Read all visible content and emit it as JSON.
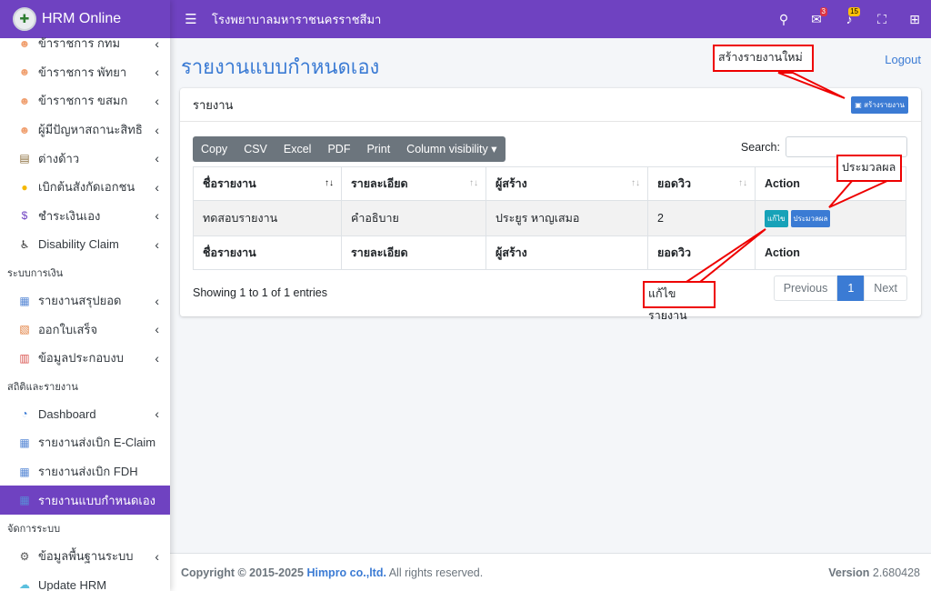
{
  "brand": {
    "name": "HRM Online"
  },
  "topbar": {
    "title": "โรงพยาบาลมหาราชนครราชสีมา",
    "chat_badge": "3",
    "bell_badge": "15"
  },
  "sidebar": {
    "items_a": [
      {
        "label": "ข้าราชการ กทม",
        "icon": "person-icon"
      },
      {
        "label": "ข้าราชการ พัทยา",
        "icon": "person-icon"
      },
      {
        "label": "ข้าราชการ ขสมก",
        "icon": "person-icon"
      },
      {
        "label": "ผู้มีปัญหาสถานะสิทธิ",
        "icon": "person-icon"
      },
      {
        "label": "ต่างด้าว",
        "icon": "passport-icon"
      },
      {
        "label": "เบิกต้นสังกัดเอกชน",
        "icon": "coin-icon"
      },
      {
        "label": "ชำระเงินเอง",
        "icon": "money-icon"
      },
      {
        "label": "Disability Claim",
        "icon": "wheelchair-icon"
      }
    ],
    "header_finance": "ระบบการเงิน",
    "items_b": [
      {
        "label": "รายงานสรุปยอด",
        "icon": "report-icon"
      },
      {
        "label": "ออกใบเสร็จ",
        "icon": "receipt-icon"
      },
      {
        "label": "ข้อมูลประกอบงบ",
        "icon": "clipboard-icon"
      }
    ],
    "header_stats": "สถิติและรายงาน",
    "items_c": [
      {
        "label": "Dashboard",
        "icon": "dashboard-icon"
      },
      {
        "label": "รายงานส่งเบิก E-Claim",
        "icon": "report-icon"
      },
      {
        "label": "รายงานส่งเบิก FDH",
        "icon": "report-icon"
      },
      {
        "label": "รายงานแบบกำหนดเอง",
        "icon": "report-icon"
      }
    ],
    "header_admin": "จัดการระบบ",
    "items_d": [
      {
        "label": "ข้อมูลพื้นฐานระบบ",
        "icon": "user-gear-icon"
      },
      {
        "label": "Update HRM",
        "icon": "cloud-icon"
      }
    ]
  },
  "page": {
    "title": "รายงานแบบกำหนดเอง",
    "logout": "Logout"
  },
  "card": {
    "title": "รายงาน",
    "create_button": "สร้างรายงาน"
  },
  "toolbar": {
    "buttons": [
      "Copy",
      "CSV",
      "Excel",
      "PDF",
      "Print",
      "Column visibility ▾"
    ],
    "search_label": "Search:"
  },
  "table": {
    "columns": [
      "ชื่อรายงาน",
      "รายละเอียด",
      "ผู้สร้าง",
      "ยอดวิว",
      "Action"
    ],
    "rows": [
      {
        "name": "ทดสอบรายงาน",
        "detail": "คำอธิบาย",
        "creator": "ประยูร หาญเสมอ",
        "views": "2",
        "edit": "แก้ไข",
        "process": "ประมวลผล"
      }
    ]
  },
  "info": "Showing 1 to 1 of 1 entries",
  "pager": {
    "prev": "Previous",
    "current": "1",
    "next": "Next"
  },
  "footer": {
    "copy_prefix": "Copyright © 2015-2025 ",
    "company": "Himpro co.,ltd.",
    "rights": " All rights reserved.",
    "version_label": "Version",
    "version": " 2.680428"
  },
  "callouts": {
    "create": "สร้างรายงานใหม่",
    "process": "ประมวลผล",
    "edit": "แก้ไขรายงาน"
  }
}
